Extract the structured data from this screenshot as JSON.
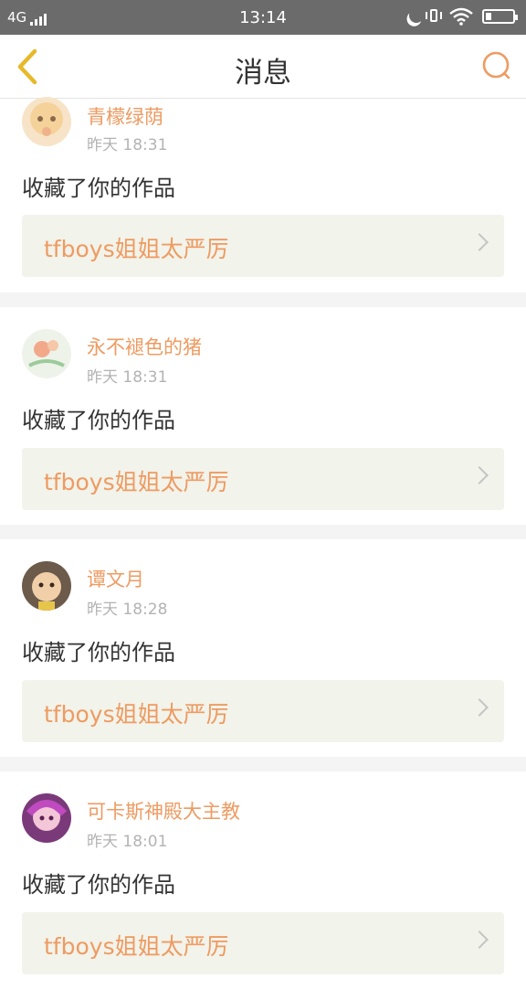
{
  "status_bar": {
    "network": "4G",
    "time": "13:14",
    "icons": [
      "signal-icon",
      "moon-icon",
      "vibrate-icon",
      "wifi-icon",
      "battery-icon"
    ]
  },
  "header": {
    "title": "消息",
    "back_icon": "chevron-left-icon",
    "search_icon": "search-icon"
  },
  "colors": {
    "accent": "#ee9b62",
    "back_icon": "#e7b92a",
    "card_bg": "#f2f3ea"
  },
  "messages": [
    {
      "user": "青檬绿荫",
      "time": "昨天 18:31",
      "action": "收藏了你的作品",
      "work_title": "tfboys姐姐太严厉"
    },
    {
      "user": "永不褪色的猪",
      "time": "昨天 18:31",
      "action": "收藏了你的作品",
      "work_title": "tfboys姐姐太严厉"
    },
    {
      "user": "谭文月",
      "time": "昨天 18:28",
      "action": "收藏了你的作品",
      "work_title": "tfboys姐姐太严厉"
    },
    {
      "user": "可卡斯神殿大主教",
      "time": "昨天 18:01",
      "action": "收藏了你的作品",
      "work_title": "tfboys姐姐太严厉"
    }
  ]
}
